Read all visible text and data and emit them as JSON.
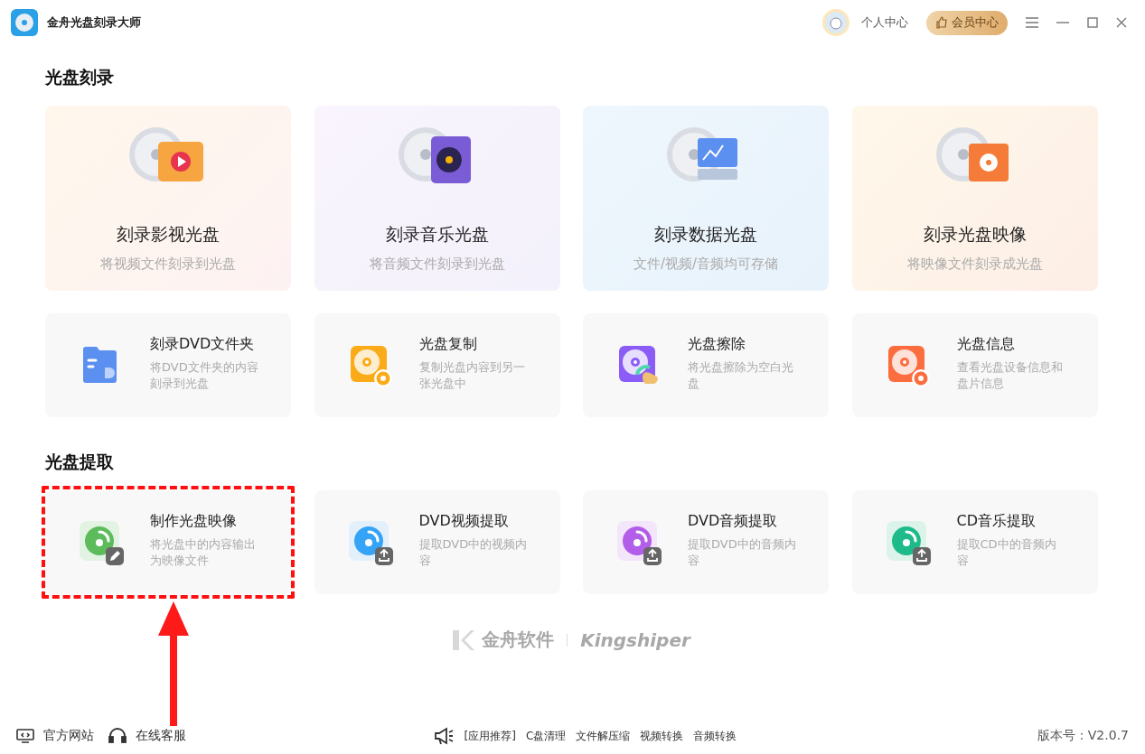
{
  "app": {
    "title": "金舟光盘刻录大师"
  },
  "header": {
    "profile_label": "个人中心",
    "vip_label": "会员中心"
  },
  "sections": [
    {
      "title": "光盘刻录",
      "big_cards": [
        {
          "kind": "video",
          "title": "刻录影视光盘",
          "desc": "将视频文件刻录到光盘"
        },
        {
          "kind": "music",
          "title": "刻录音乐光盘",
          "desc": "将音频文件刻录到光盘"
        },
        {
          "kind": "data",
          "title": "刻录数据光盘",
          "desc": "文件/视频/音频均可存储"
        },
        {
          "kind": "image",
          "title": "刻录光盘映像",
          "desc": "将映像文件刻录成光盘"
        }
      ],
      "cards": [
        {
          "kind": "dvd-folder",
          "title": "刻录DVD文件夹",
          "desc": "将DVD文件夹的内容刻录到光盘",
          "highlighted": false
        },
        {
          "kind": "copy",
          "title": "光盘复制",
          "desc": "复制光盘内容到另一张光盘中",
          "highlighted": false
        },
        {
          "kind": "erase",
          "title": "光盘擦除",
          "desc": "将光盘擦除为空白光盘",
          "highlighted": false
        },
        {
          "kind": "info",
          "title": "光盘信息",
          "desc": "查看光盘设备信息和盘片信息",
          "highlighted": false
        }
      ]
    },
    {
      "title": "光盘提取",
      "cards": [
        {
          "kind": "make-image",
          "title": "制作光盘映像",
          "desc": "将光盘中的内容输出为映像文件",
          "highlighted": true
        },
        {
          "kind": "dvd-video",
          "title": "DVD视频提取",
          "desc": "提取DVD中的视频内容",
          "highlighted": false
        },
        {
          "kind": "dvd-audio",
          "title": "DVD音频提取",
          "desc": "提取DVD中的音频内容",
          "highlighted": false
        },
        {
          "kind": "cd-music",
          "title": "CD音乐提取",
          "desc": "提取CD中的音频内容",
          "highlighted": false
        }
      ]
    }
  ],
  "brand": {
    "name_cn": "金舟软件",
    "name_en": "Kingshiper"
  },
  "footer": {
    "links": [
      {
        "kind": "website",
        "label": "官方网站"
      },
      {
        "kind": "support",
        "label": "在线客服"
      }
    ],
    "recommend_label": "[应用推荐]",
    "apps": [
      "C盘清理",
      "文件解压缩",
      "视频转换",
      "音频转换"
    ],
    "version": "版本号：V2.0.7"
  }
}
